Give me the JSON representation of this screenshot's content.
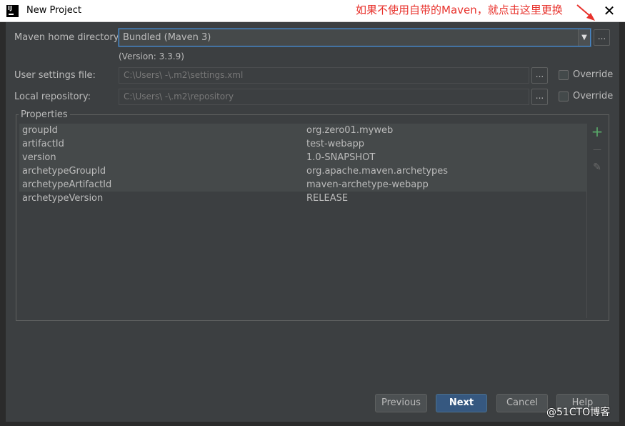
{
  "window": {
    "title": "New Project",
    "close_glyph": "✕"
  },
  "annotation": {
    "text": "如果不使用自带的Maven，就点击这里更换",
    "color": "#e8322c"
  },
  "maven_home": {
    "label": "Maven home directory:",
    "selected": "Bundled (Maven 3)",
    "version": "(Version: 3.3.9)",
    "browse": "..."
  },
  "user_settings": {
    "label": "User settings file:",
    "value": "C:\\Users\\ -\\.m2\\settings.xml",
    "browse": "...",
    "override_label": "Override"
  },
  "local_repo": {
    "label": "Local repository:",
    "value": "C:\\Users\\ -\\.m2\\repository",
    "browse": "...",
    "override_label": "Override"
  },
  "properties": {
    "title": "Properties",
    "rows": [
      {
        "key": "groupId",
        "value": "org.zero01.myweb"
      },
      {
        "key": "artifactId",
        "value": "test-webapp"
      },
      {
        "key": "version",
        "value": "1.0-SNAPSHOT"
      },
      {
        "key": "archetypeGroupId",
        "value": "org.apache.maven.archetypes"
      },
      {
        "key": "archetypeArtifactId",
        "value": "maven-archetype-webapp"
      },
      {
        "key": "archetypeVersion",
        "value": "RELEASE"
      }
    ],
    "toolbar": {
      "add": "+",
      "remove": "—",
      "edit": "✎"
    }
  },
  "buttons": {
    "previous": "Previous",
    "next": "Next",
    "cancel": "Cancel",
    "help": "Help"
  },
  "watermark": "@51CTO博客",
  "colors": {
    "background": "#3c3f41",
    "accent": "#365880",
    "focus": "#4a88c7",
    "add_icon": "#59a869"
  }
}
